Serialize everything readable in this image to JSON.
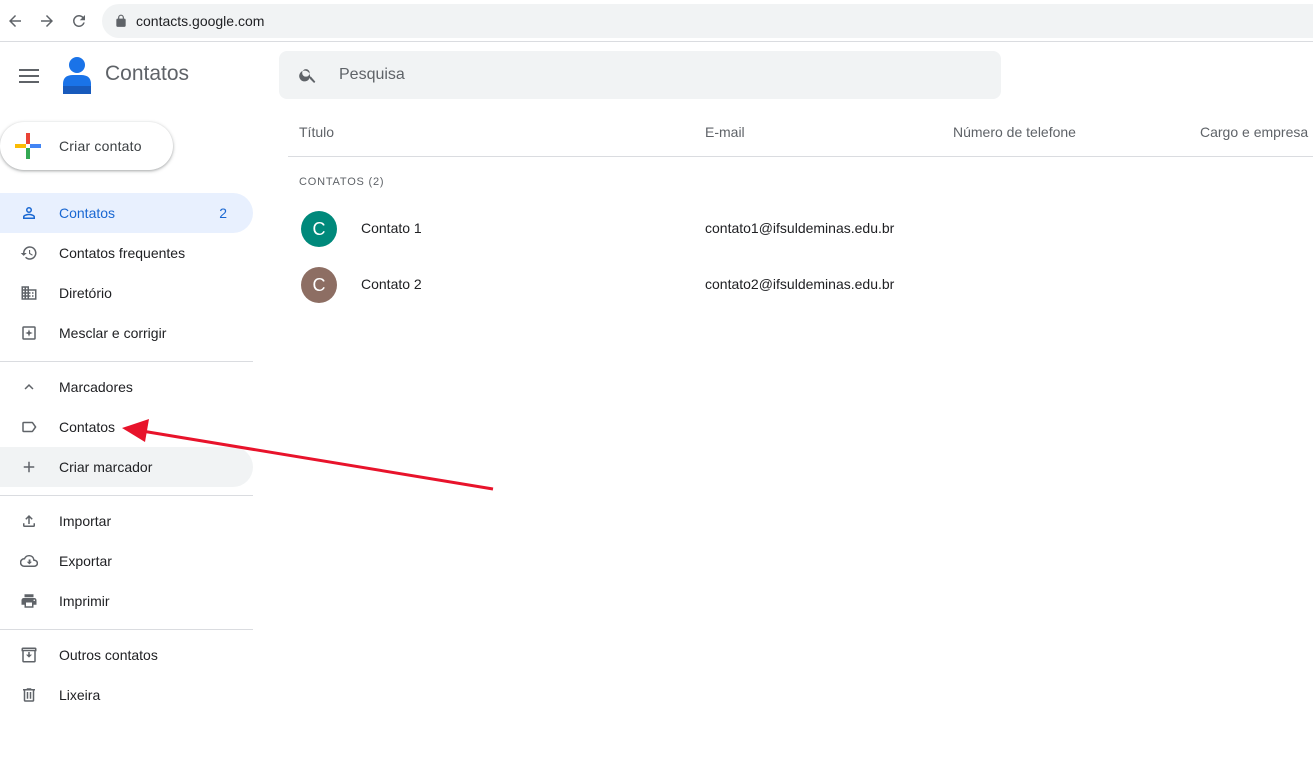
{
  "browser": {
    "url": "contacts.google.com",
    "icons": [
      "back-arrow-icon",
      "forward-arrow-icon",
      "reload-icon",
      "lock-icon"
    ]
  },
  "header": {
    "app_title": "Contatos",
    "search_placeholder": "Pesquisa"
  },
  "create_button": {
    "label": "Criar contato"
  },
  "sidebar": {
    "main_items": [
      {
        "label": "Contatos",
        "count": "2",
        "icon": "person-icon"
      },
      {
        "label": "Contatos frequentes",
        "icon": "history-icon"
      },
      {
        "label": "Diretório",
        "icon": "domain-icon"
      },
      {
        "label": "Mesclar e corrigir",
        "icon": "merge-fix-icon"
      }
    ],
    "labels_section": {
      "header": "Marcadores",
      "items": [
        {
          "label": "Contatos",
          "icon": "label-icon"
        },
        {
          "label": "Criar marcador",
          "icon": "plus-icon"
        }
      ]
    },
    "actions": [
      {
        "label": "Importar",
        "icon": "upload-icon"
      },
      {
        "label": "Exportar",
        "icon": "cloud-download-icon"
      },
      {
        "label": "Imprimir",
        "icon": "printer-icon"
      }
    ],
    "other": [
      {
        "label": "Outros contatos",
        "icon": "archive-icon"
      },
      {
        "label": "Lixeira",
        "icon": "trash-icon"
      }
    ]
  },
  "table": {
    "headers": [
      "Título",
      "E-mail",
      "Número de telefone",
      "Cargo e empresa"
    ],
    "section_label": "CONTATOS (2)",
    "rows": [
      {
        "initial": "C",
        "name": "Contato 1",
        "email": "contato1@ifsuldeminas.edu.br",
        "avatar_color": "#00897b"
      },
      {
        "initial": "C",
        "name": "Contato 2",
        "email": "contato2@ifsuldeminas.edu.br",
        "avatar_color": "#8d6e63"
      }
    ]
  },
  "colors": {
    "accent": "#1967d2",
    "active_bg": "#e8f0fe",
    "annotation_arrow": "#e8132b"
  }
}
